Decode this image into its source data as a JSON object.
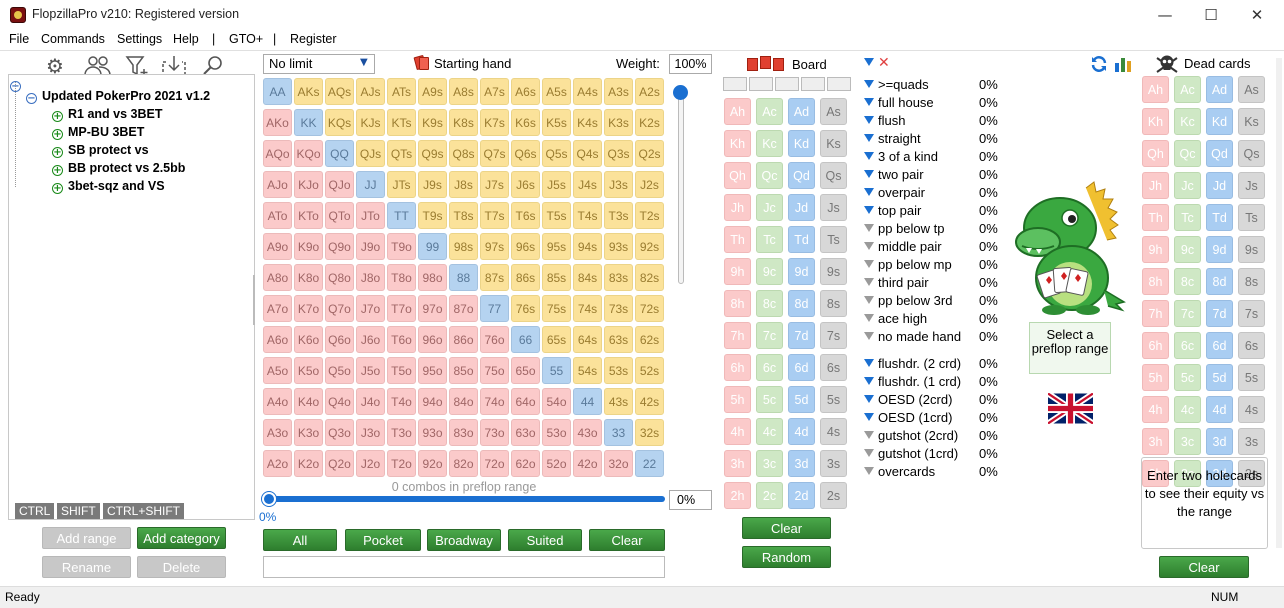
{
  "window": {
    "title": "FlopzillaPro v210: Registered version",
    "minimize": "—",
    "maximize": "☐",
    "close": "✕"
  },
  "menu": [
    "File",
    "Commands",
    "Settings",
    "Help",
    "|",
    "GTO+",
    "|",
    "Register"
  ],
  "toolbar_icons": [
    "gear-icon",
    "users-icon",
    "filter-add-icon",
    "import-icon",
    "search-icon"
  ],
  "tree": {
    "root": "Updated PokerPro 2021 v1.2",
    "items": [
      "R1 and vs 3BET",
      "MP-BU 3BET",
      "SB protect vs",
      "BB protect vs 2.5bb",
      "3bet-sqz and VS"
    ]
  },
  "modifier_keys": [
    "CTRL",
    "SHIFT",
    "CTRL+SHIFT"
  ],
  "tree_buttons": {
    "add_range": "Add range",
    "add_category": "Add category",
    "rename": "Rename",
    "delete": "Delete"
  },
  "range": {
    "limit_select": "No limit",
    "starting_hand_label": "Starting hand",
    "weight_label": "Weight:",
    "weight_value": "100%",
    "combos_text": "0 combos in preflop range",
    "slider_percent": "0%",
    "slider_value": "0%",
    "grid": [
      [
        "AA",
        "AKs",
        "AQs",
        "AJs",
        "ATs",
        "A9s",
        "A8s",
        "A7s",
        "A6s",
        "A5s",
        "A4s",
        "A3s",
        "A2s"
      ],
      [
        "AKo",
        "KK",
        "KQs",
        "KJs",
        "KTs",
        "K9s",
        "K8s",
        "K7s",
        "K6s",
        "K5s",
        "K4s",
        "K3s",
        "K2s"
      ],
      [
        "AQo",
        "KQo",
        "QQ",
        "QJs",
        "QTs",
        "Q9s",
        "Q8s",
        "Q7s",
        "Q6s",
        "Q5s",
        "Q4s",
        "Q3s",
        "Q2s"
      ],
      [
        "AJo",
        "KJo",
        "QJo",
        "JJ",
        "JTs",
        "J9s",
        "J8s",
        "J7s",
        "J6s",
        "J5s",
        "J4s",
        "J3s",
        "J2s"
      ],
      [
        "ATo",
        "KTo",
        "QTo",
        "JTo",
        "TT",
        "T9s",
        "T8s",
        "T7s",
        "T6s",
        "T5s",
        "T4s",
        "T3s",
        "T2s"
      ],
      [
        "A9o",
        "K9o",
        "Q9o",
        "J9o",
        "T9o",
        "99",
        "98s",
        "97s",
        "96s",
        "95s",
        "94s",
        "93s",
        "92s"
      ],
      [
        "A8o",
        "K8o",
        "Q8o",
        "J8o",
        "T8o",
        "98o",
        "88",
        "87s",
        "86s",
        "85s",
        "84s",
        "83s",
        "82s"
      ],
      [
        "A7o",
        "K7o",
        "Q7o",
        "J7o",
        "T7o",
        "97o",
        "87o",
        "77",
        "76s",
        "75s",
        "74s",
        "73s",
        "72s"
      ],
      [
        "A6o",
        "K6o",
        "Q6o",
        "J6o",
        "T6o",
        "96o",
        "86o",
        "76o",
        "66",
        "65s",
        "64s",
        "63s",
        "62s"
      ],
      [
        "A5o",
        "K5o",
        "Q5o",
        "J5o",
        "T5o",
        "95o",
        "85o",
        "75o",
        "65o",
        "55",
        "54s",
        "53s",
        "52s"
      ],
      [
        "A4o",
        "K4o",
        "Q4o",
        "J4o",
        "T4o",
        "94o",
        "84o",
        "74o",
        "64o",
        "54o",
        "44",
        "43s",
        "42s"
      ],
      [
        "A3o",
        "K3o",
        "Q3o",
        "J3o",
        "T3o",
        "93o",
        "83o",
        "73o",
        "63o",
        "53o",
        "43o",
        "33",
        "32s"
      ],
      [
        "A2o",
        "K2o",
        "Q2o",
        "J2o",
        "T2o",
        "92o",
        "82o",
        "72o",
        "62o",
        "52o",
        "42o",
        "32o",
        "22"
      ]
    ],
    "buttons": [
      "All",
      "Pocket",
      "Broadway",
      "Suited",
      "Clear"
    ]
  },
  "board": {
    "label": "Board",
    "ranks": [
      "A",
      "K",
      "Q",
      "J",
      "T",
      "9",
      "8",
      "7",
      "6",
      "5",
      "4",
      "3",
      "2"
    ],
    "suits": [
      "h",
      "c",
      "d",
      "s"
    ],
    "clear": "Clear",
    "random": "Random"
  },
  "hands": {
    "made": [
      {
        "name": ">=quads",
        "pct": "0%",
        "active": true
      },
      {
        "name": "full house",
        "pct": "0%",
        "active": true
      },
      {
        "name": "flush",
        "pct": "0%",
        "active": true
      },
      {
        "name": "straight",
        "pct": "0%",
        "active": true
      },
      {
        "name": "3 of a kind",
        "pct": "0%",
        "active": true
      },
      {
        "name": "two pair",
        "pct": "0%",
        "active": true
      },
      {
        "name": "overpair",
        "pct": "0%",
        "active": true
      },
      {
        "name": "top pair",
        "pct": "0%",
        "active": true
      },
      {
        "name": "pp below tp",
        "pct": "0%",
        "active": false
      },
      {
        "name": "middle pair",
        "pct": "0%",
        "active": false
      },
      {
        "name": "pp below mp",
        "pct": "0%",
        "active": false
      },
      {
        "name": "third pair",
        "pct": "0%",
        "active": false
      },
      {
        "name": "pp below 3rd",
        "pct": "0%",
        "active": false
      },
      {
        "name": "ace high",
        "pct": "0%",
        "active": false
      },
      {
        "name": "no made hand",
        "pct": "0%",
        "active": false
      }
    ],
    "draws": [
      {
        "name": "flushdr. (2 crd)",
        "pct": "0%",
        "active": true
      },
      {
        "name": "flushdr. (1 crd)",
        "pct": "0%",
        "active": true
      },
      {
        "name": "OESD (2crd)",
        "pct": "0%",
        "active": true
      },
      {
        "name": "OESD (1crd)",
        "pct": "0%",
        "active": true
      },
      {
        "name": "gutshot (2crd)",
        "pct": "0%",
        "active": false
      },
      {
        "name": "gutshot (1crd)",
        "pct": "0%",
        "active": false
      },
      {
        "name": "overcards",
        "pct": "0%",
        "active": false
      }
    ]
  },
  "select_box": "Select a preflop range",
  "dead": {
    "label": "Dead cards",
    "hint": "Enter two holecards to see their equity vs the range",
    "clear": "Clear"
  },
  "status": {
    "left": "Ready",
    "right": "NUM"
  }
}
